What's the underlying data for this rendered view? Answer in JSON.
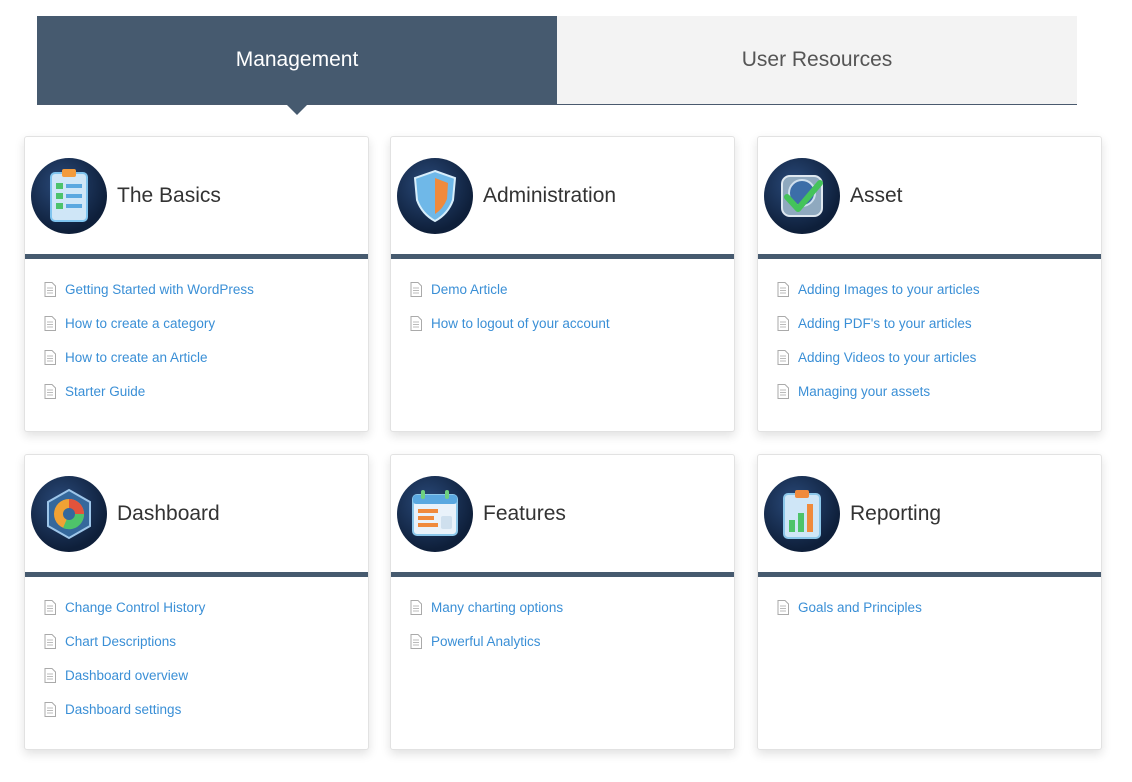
{
  "tabs": [
    {
      "label": "Management",
      "active": true
    },
    {
      "label": "User Resources",
      "active": false
    }
  ],
  "colors": {
    "accent": "#465a6f",
    "link": "#3a8fd6"
  },
  "categories": [
    {
      "title": "The Basics",
      "icon": "clipboard-icon",
      "links": [
        "Getting Started with WordPress",
        "How to create a category",
        "How to create an Article",
        "Starter Guide"
      ]
    },
    {
      "title": "Administration",
      "icon": "shield-icon",
      "links": [
        "Demo Article",
        "How to logout of your account"
      ]
    },
    {
      "title": "Asset",
      "icon": "checkmark-icon",
      "links": [
        "Adding Images to your articles",
        "Adding PDF's to your articles",
        "Adding Videos to your articles",
        "Managing your assets"
      ]
    },
    {
      "title": "Dashboard",
      "icon": "pie-chart-icon",
      "links": [
        "Change Control History",
        "Chart Descriptions",
        "Dashboard overview",
        "Dashboard settings"
      ]
    },
    {
      "title": "Features",
      "icon": "calendar-chart-icon",
      "links": [
        "Many charting options",
        "Powerful Analytics"
      ]
    },
    {
      "title": "Reporting",
      "icon": "bar-chart-icon",
      "links": [
        "Goals and Principles"
      ]
    }
  ]
}
